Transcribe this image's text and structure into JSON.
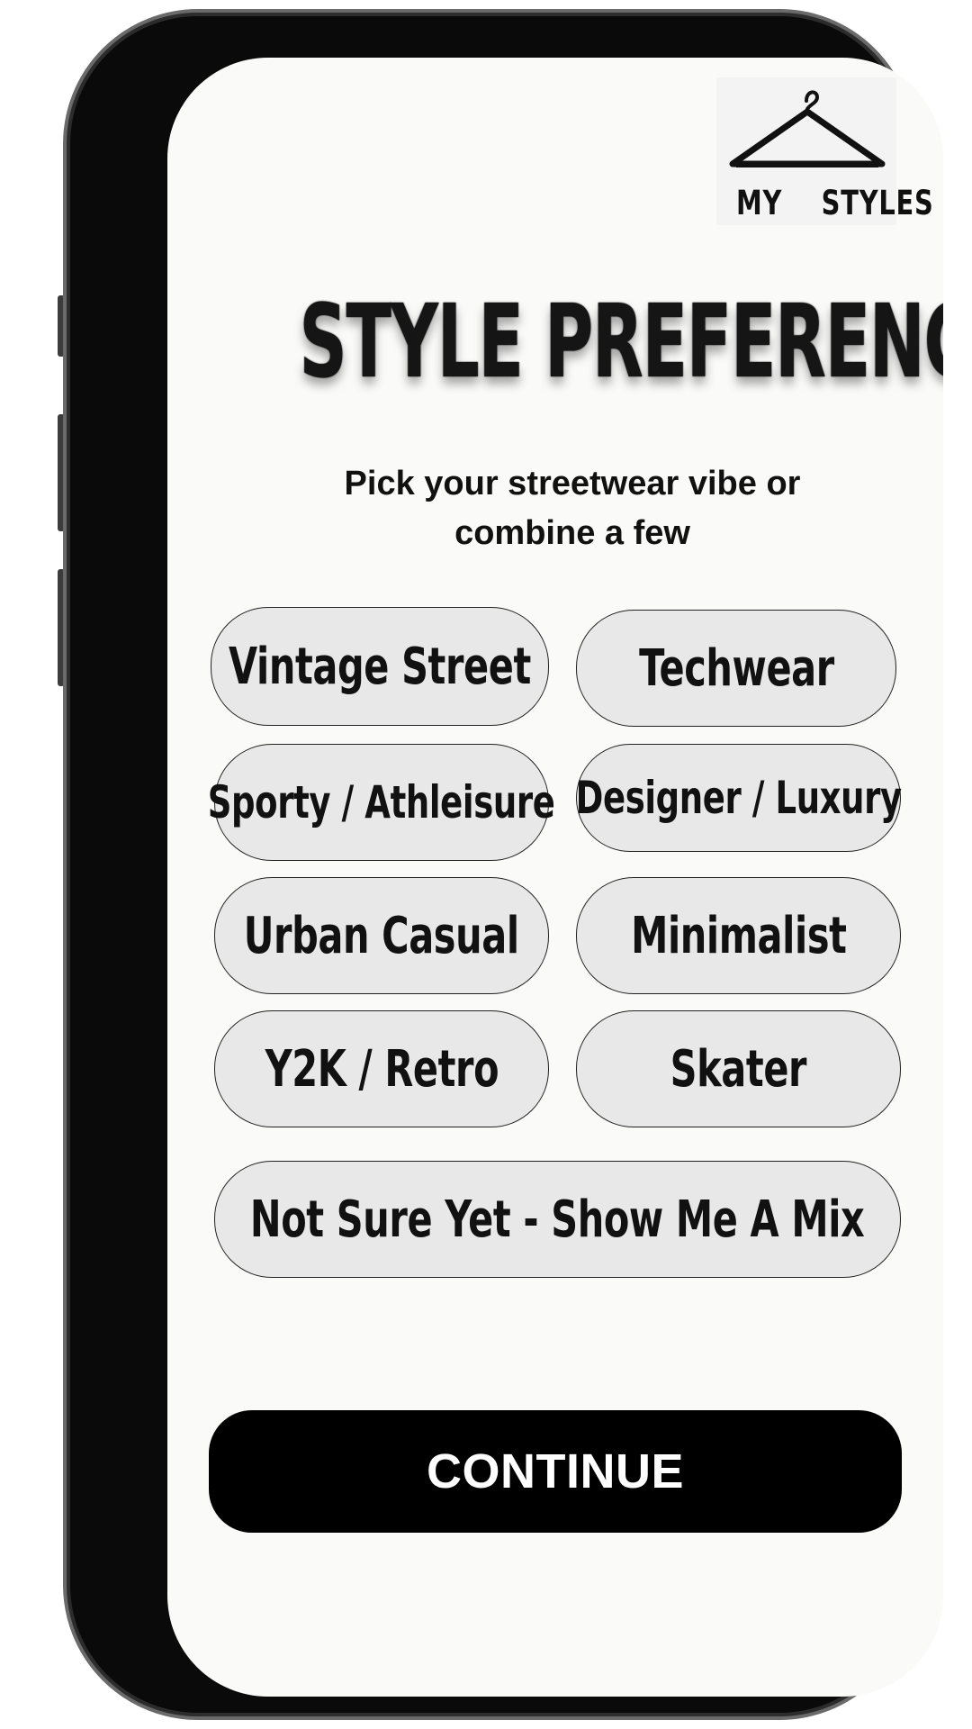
{
  "brand": {
    "logo_text": "MY  STYLES",
    "logo_icon": "hanger-icon"
  },
  "page": {
    "title": "STYLE PREFERENCES",
    "subtitle": "Pick your streetwear vibe or combine a few"
  },
  "options": [
    {
      "label": "Vintage Street"
    },
    {
      "label": "Techwear"
    },
    {
      "label": "Sporty / Athleisure"
    },
    {
      "label": "Designer / Luxury"
    },
    {
      "label": "Urban Casual"
    },
    {
      "label": "Minimalist"
    },
    {
      "label": "Y2K / Retro"
    },
    {
      "label": "Skater"
    },
    {
      "label": "Not Sure Yet - Show Me A Mix"
    }
  ],
  "actions": {
    "continue_label": "CONTINUE"
  },
  "colors": {
    "screen_background": "#fafaf9",
    "option_background": "#e8e8e8",
    "primary_button": "#000000",
    "frame": "#0a0a0a"
  }
}
